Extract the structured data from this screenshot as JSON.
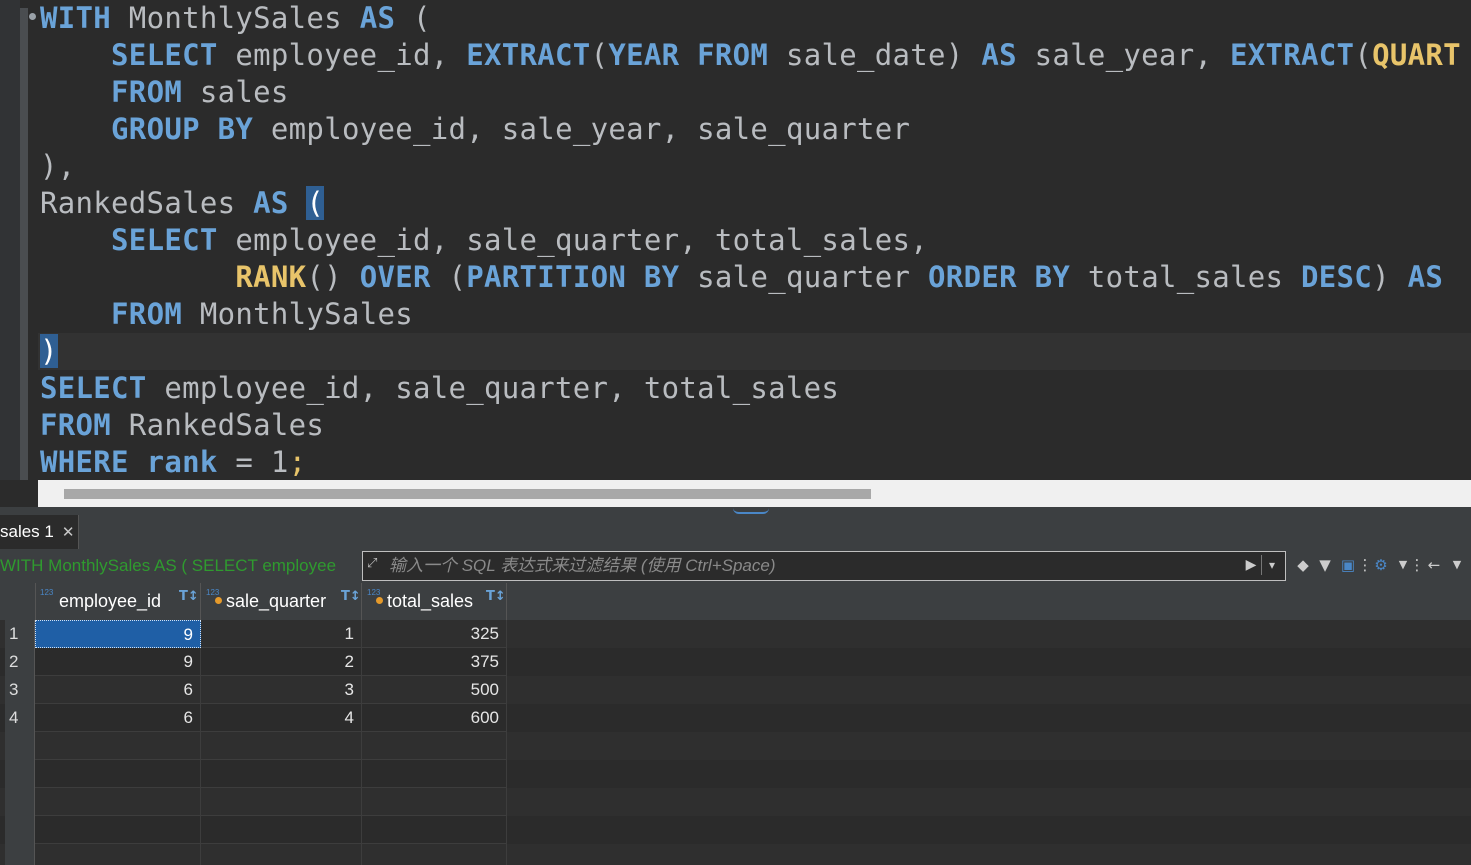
{
  "editor": {
    "lines": [
      [
        {
          "t": "WITH",
          "c": "kw"
        },
        {
          "t": " MonthlySales ",
          "c": "id"
        },
        {
          "t": "AS",
          "c": "kw"
        },
        {
          "t": " (",
          "c": "pn"
        }
      ],
      [
        {
          "t": "    ",
          "c": "id"
        },
        {
          "t": "SELECT",
          "c": "kw"
        },
        {
          "t": " employee_id, ",
          "c": "id"
        },
        {
          "t": "EXTRACT",
          "c": "kw"
        },
        {
          "t": "(",
          "c": "pn"
        },
        {
          "t": "YEAR",
          "c": "kw"
        },
        {
          "t": " ",
          "c": "id"
        },
        {
          "t": "FROM",
          "c": "kw"
        },
        {
          "t": " sale_date) ",
          "c": "id"
        },
        {
          "t": "AS",
          "c": "kw"
        },
        {
          "t": " sale_year, ",
          "c": "id"
        },
        {
          "t": "EXTRACT",
          "c": "kw"
        },
        {
          "t": "(",
          "c": "pn"
        },
        {
          "t": "QUART",
          "c": "fn"
        }
      ],
      [
        {
          "t": "    ",
          "c": "id"
        },
        {
          "t": "FROM",
          "c": "kw"
        },
        {
          "t": " sales",
          "c": "id"
        }
      ],
      [
        {
          "t": "    ",
          "c": "id"
        },
        {
          "t": "GROUP",
          "c": "kw"
        },
        {
          "t": " ",
          "c": "id"
        },
        {
          "t": "BY",
          "c": "kw"
        },
        {
          "t": " employee_id, sale_year, sale_quarter",
          "c": "id"
        }
      ],
      [
        {
          "t": "),",
          "c": "pn"
        }
      ],
      [
        {
          "t": "RankedSales ",
          "c": "id"
        },
        {
          "t": "AS",
          "c": "kw"
        },
        {
          "t": " ",
          "c": "id"
        },
        {
          "t": "(",
          "c": "hl"
        }
      ],
      [
        {
          "t": "    ",
          "c": "id"
        },
        {
          "t": "SELECT",
          "c": "kw"
        },
        {
          "t": " employee_id, sale_quarter, total_sales,",
          "c": "id"
        }
      ],
      [
        {
          "t": "           ",
          "c": "id"
        },
        {
          "t": "RANK",
          "c": "fn"
        },
        {
          "t": "() ",
          "c": "pn"
        },
        {
          "t": "OVER",
          "c": "kw"
        },
        {
          "t": " (",
          "c": "pn"
        },
        {
          "t": "PARTITION",
          "c": "kw"
        },
        {
          "t": " ",
          "c": "id"
        },
        {
          "t": "BY",
          "c": "kw"
        },
        {
          "t": " sale_quarter ",
          "c": "id"
        },
        {
          "t": "ORDER",
          "c": "kw"
        },
        {
          "t": " ",
          "c": "id"
        },
        {
          "t": "BY",
          "c": "kw"
        },
        {
          "t": " total_sales ",
          "c": "id"
        },
        {
          "t": "DESC",
          "c": "kw"
        },
        {
          "t": ") ",
          "c": "pn"
        },
        {
          "t": "AS",
          "c": "kw"
        }
      ],
      [
        {
          "t": "    ",
          "c": "id"
        },
        {
          "t": "FROM",
          "c": "kw"
        },
        {
          "t": " MonthlySales",
          "c": "id"
        }
      ],
      [
        {
          "t": ")",
          "c": "hl"
        }
      ],
      [
        {
          "t": "SELECT",
          "c": "kw"
        },
        {
          "t": " employee_id, sale_quarter, total_sales",
          "c": "id"
        }
      ],
      [
        {
          "t": "FROM",
          "c": "kw"
        },
        {
          "t": " RankedSales",
          "c": "id"
        }
      ],
      [
        {
          "t": "WHERE",
          "c": "kw"
        },
        {
          "t": " ",
          "c": "id"
        },
        {
          "t": "rank",
          "c": "kw"
        },
        {
          "t": " = ",
          "c": "pn"
        },
        {
          "t": "1",
          "c": "num"
        },
        {
          "t": ";",
          "c": "sc"
        }
      ]
    ]
  },
  "results_tab": {
    "label": "sales 1",
    "close_icon": "close-icon"
  },
  "filter": {
    "query_label": "WITH MonthlySales AS ( SELECT employee",
    "placeholder": "输入一个 SQL 表达式来过滤结果 (使用 Ctrl+Space)",
    "apply_icon": "play-icon",
    "history_icon": "dropdown-icon"
  },
  "toolbar_icons": [
    "eraser-icon",
    "filter-icon",
    "filter-settings-icon",
    "more-icon",
    "panel-icon",
    "dropdown-icon",
    "more-icon",
    "back-arrow-icon",
    "dropdown-icon"
  ],
  "grid": {
    "columns": [
      {
        "name": "employee_id",
        "type": "123",
        "key": false
      },
      {
        "name": "sale_quarter",
        "type": "123",
        "key": true
      },
      {
        "name": "total_sales",
        "type": "123",
        "key": true
      }
    ],
    "rows": [
      {
        "num": "1",
        "cells": [
          "9",
          "1",
          "325"
        ]
      },
      {
        "num": "2",
        "cells": [
          "9",
          "2",
          "375"
        ]
      },
      {
        "num": "3",
        "cells": [
          "6",
          "3",
          "500"
        ]
      },
      {
        "num": "4",
        "cells": [
          "6",
          "4",
          "600"
        ]
      }
    ],
    "selected_cell": {
      "row": 0,
      "col": 0
    }
  },
  "colors": {
    "keyword": "#6aa3d8",
    "function": "#e8c46a",
    "identifier": "#b9bcc0",
    "selection": "#1f5fa6",
    "query_label": "#2f9a2f"
  }
}
